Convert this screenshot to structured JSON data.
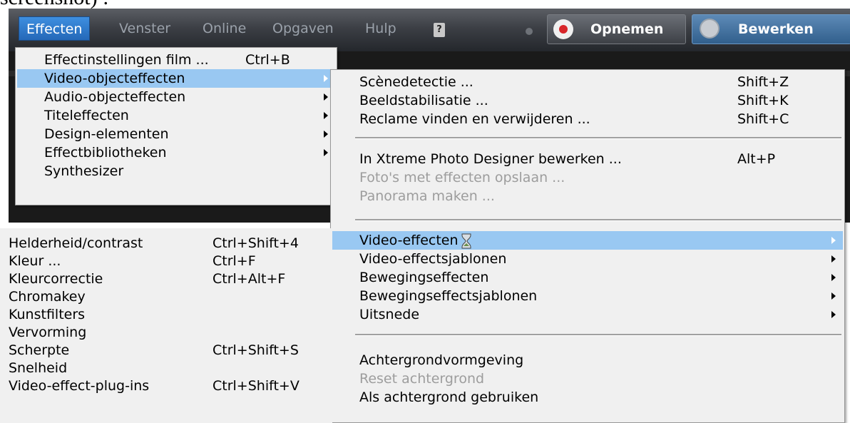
{
  "caption": "screenshot) :",
  "menubar": {
    "items": [
      "Effecten",
      "Venster",
      "Online",
      "Opgaven",
      "Hulp"
    ],
    "record_button": "Opnemen",
    "edit_button": "Bewerken"
  },
  "effects_menu": {
    "items": [
      {
        "label": "Effectinstellingen film ...",
        "shortcut": "Ctrl+B"
      },
      {
        "label": "Video-objecteffecten",
        "submenu": true,
        "highlighted": true
      },
      {
        "label": "Audio-objecteffecten",
        "submenu": true
      },
      {
        "label": "Titeleffecten",
        "submenu": true
      },
      {
        "label": "Design-elementen",
        "submenu": true
      },
      {
        "label": "Effectbibliotheken",
        "submenu": true
      },
      {
        "label": "Synthesizer"
      }
    ]
  },
  "video_object_menu": {
    "group1": [
      {
        "label": "Scènedetectie ...",
        "shortcut": "Shift+Z"
      },
      {
        "label": "Beeldstabilisatie ...",
        "shortcut": "Shift+K"
      },
      {
        "label": "Reclame vinden en verwijderen ...",
        "shortcut": "Shift+C"
      }
    ],
    "group2": [
      {
        "label": "In Xtreme Photo Designer bewerken ...",
        "shortcut": "Alt+P"
      },
      {
        "label": "Foto's met effecten opslaan ...",
        "disabled": true
      },
      {
        "label": "Panorama maken ...",
        "disabled": true
      }
    ],
    "group3": [
      {
        "label": "Video-effecten",
        "submenu": true,
        "highlighted": true
      },
      {
        "label": "Video-effectsjablonen",
        "submenu": true
      },
      {
        "label": "Bewegingseffecten",
        "submenu": true
      },
      {
        "label": "Bewegingseffectsjablonen",
        "submenu": true
      },
      {
        "label": "Uitsnede",
        "submenu": true
      }
    ],
    "group4": [
      {
        "label": "Achtergrondvormgeving"
      },
      {
        "label": "Reset achtergrond",
        "disabled": true
      },
      {
        "label": "Als achtergrond gebruiken"
      }
    ]
  },
  "video_effects_menu": {
    "items": [
      {
        "label": "Helderheid/contrast",
        "shortcut": "Ctrl+Shift+4"
      },
      {
        "label": "Kleur ...",
        "shortcut": "Ctrl+F"
      },
      {
        "label": "Kleurcorrectie",
        "shortcut": "Ctrl+Alt+F"
      },
      {
        "label": "Chromakey",
        "shortcut": ""
      },
      {
        "label": "Kunstfilters",
        "shortcut": ""
      },
      {
        "label": "Vervorming",
        "shortcut": ""
      },
      {
        "label": "Scherpte",
        "shortcut": "Ctrl+Shift+S"
      },
      {
        "label": "Snelheid",
        "shortcut": ""
      },
      {
        "label": "Video-effect-plug-ins",
        "shortcut": "Ctrl+Shift+V"
      }
    ]
  },
  "colors": {
    "highlight": "#99c8f2",
    "active_menu": "#2f7bd0",
    "menu_bg": "#f0f0f0",
    "disabled_text": "#9d9d9d"
  }
}
